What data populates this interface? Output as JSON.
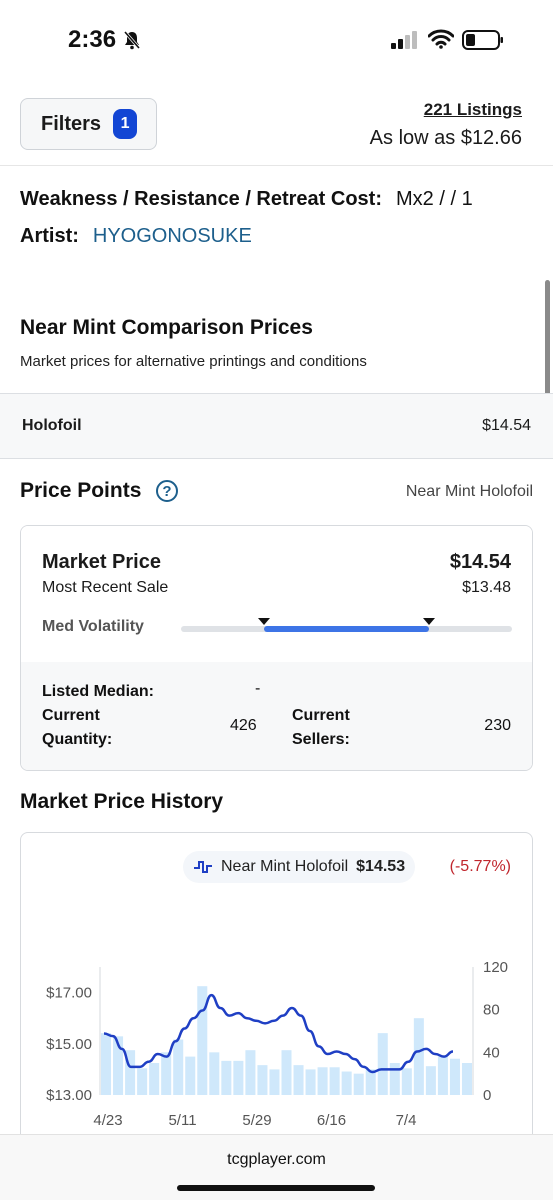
{
  "status_bar": {
    "time": "2:36"
  },
  "header": {
    "filters_label": "Filters",
    "filters_count": "1",
    "listings": "221 Listings",
    "as_low_as": "As low as $12.66"
  },
  "details": {
    "weakness_key": "Weakness / Resistance / Retreat Cost:",
    "weakness_val": "Mx2 / / 1",
    "artist_key": "Artist:",
    "artist_val": "HYOGONOSUKE"
  },
  "comparison": {
    "title": "Near Mint Comparison Prices",
    "subtitle": "Market prices for alternative printings and conditions",
    "rows": [
      {
        "name": "Holofoil",
        "price": "$14.54"
      }
    ]
  },
  "price_points": {
    "title": "Price Points",
    "help": "?",
    "filter": "Near Mint Holofoil",
    "market_price_label": "Market Price",
    "market_price": "$14.54",
    "recent_sale_label": "Most Recent Sale",
    "recent_sale": "$13.48",
    "volatility_label": "Med Volatility",
    "volatility_range": [
      0.25,
      0.75
    ],
    "listed_median_label": "Listed Median:",
    "listed_median": "-",
    "current_quantity_label_1": "Current",
    "current_quantity_label_2": "Quantity:",
    "current_quantity": "426",
    "current_sellers_label_1": "Current",
    "current_sellers_label_2": "Sellers:",
    "current_sellers": "230"
  },
  "history": {
    "title": "Market Price History",
    "legend_name": "Near Mint Holofoil",
    "legend_price": "$14.53",
    "legend_change": "(-5.77%)"
  },
  "colors": {
    "accent": "#1346d4",
    "line": "#1f3fc4",
    "bar": "#cfe8fb",
    "negative": "#c0262d",
    "link": "#1d5f8c"
  },
  "chart_data": {
    "type": "line",
    "x_ticks": [
      "4/23",
      "5/11",
      "5/29",
      "6/16",
      "7/4"
    ],
    "y_left_ticks": [
      "$17.00",
      "$15.00",
      "$13.00"
    ],
    "y_left_range": [
      13,
      18
    ],
    "y_right_ticks": [
      "120",
      "80",
      "40",
      "0"
    ],
    "y_right_range": [
      0,
      120
    ],
    "series": [
      {
        "kind": "line",
        "values": [
          15.4,
          15.3,
          14.8,
          14.1,
          14.1,
          14.3,
          14.6,
          14.5,
          15.1,
          15.6,
          16.0,
          16.3,
          16.9,
          16.4,
          16.1,
          16.2,
          16.0,
          15.9,
          15.8,
          15.9,
          16.1,
          16.4,
          16.1,
          15.5,
          14.9,
          14.6,
          14.7,
          14.6,
          14.4,
          14.1,
          13.9,
          14.0,
          14.0,
          14.0,
          14.3,
          14.7,
          14.8,
          14.6,
          14.5,
          14.7
        ]
      },
      {
        "kind": "bar",
        "values": [
          58,
          55,
          42,
          25,
          30,
          40,
          52,
          36,
          102,
          40,
          32,
          32,
          42,
          28,
          24,
          42,
          28,
          24,
          26,
          26,
          22,
          20,
          24,
          58,
          30,
          25,
          72,
          27,
          36,
          34,
          30
        ]
      }
    ]
  }
}
